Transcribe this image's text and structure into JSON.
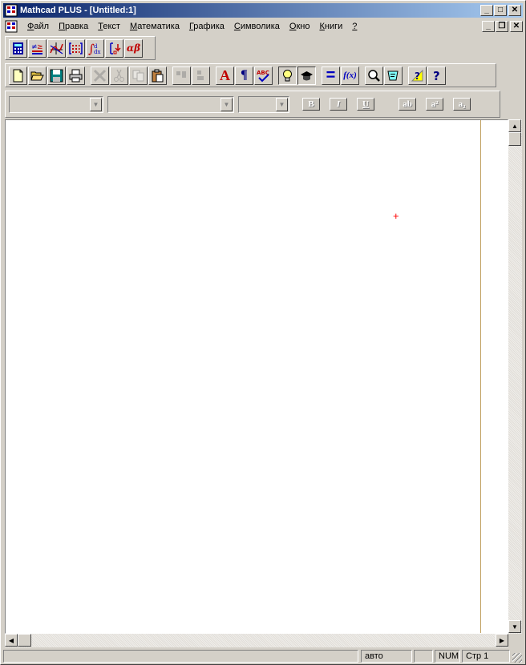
{
  "window": {
    "title": "Mathcad PLUS - [Untitled:1]",
    "caption_min": "_",
    "caption_max": "□",
    "caption_close": "✕",
    "mdi_restore": "❐"
  },
  "menu": {
    "items": [
      {
        "label": "Файл"
      },
      {
        "label": "Правка"
      },
      {
        "label": "Текст"
      },
      {
        "label": "Математика"
      },
      {
        "label": "Графика"
      },
      {
        "label": "Символика"
      },
      {
        "label": "Окно"
      },
      {
        "label": "Книги"
      },
      {
        "label": "?"
      }
    ]
  },
  "math_palette": {
    "buttons": [
      {
        "icon": "calculator-icon"
      },
      {
        "icon": "evaluation-icon"
      },
      {
        "icon": "graph-icon"
      },
      {
        "icon": "matrix-icon"
      },
      {
        "icon": "calculus-icon"
      },
      {
        "icon": "programming-icon"
      },
      {
        "icon": "greek-icon",
        "label": "αβ"
      }
    ]
  },
  "standard_toolbar": {
    "text_button_label": "A",
    "paragraph_label": "¶",
    "spell_label": "ABC",
    "fx_label": "f(x)",
    "equals_label": "="
  },
  "format_toolbar": {
    "bold_label": "B",
    "italic_label": "I",
    "underline_label": "U",
    "ab_label": "ab",
    "superscript_label": "a²",
    "subscript_label": "a₂"
  },
  "document": {
    "cursor_glyph": "+"
  },
  "status": {
    "mode": "авто",
    "num": "NUM",
    "page": "Стр 1"
  },
  "colors": {
    "title_gradient_start": "#0a246a",
    "cursor": "#ff0000",
    "window_bg": "#d4d0c8"
  }
}
